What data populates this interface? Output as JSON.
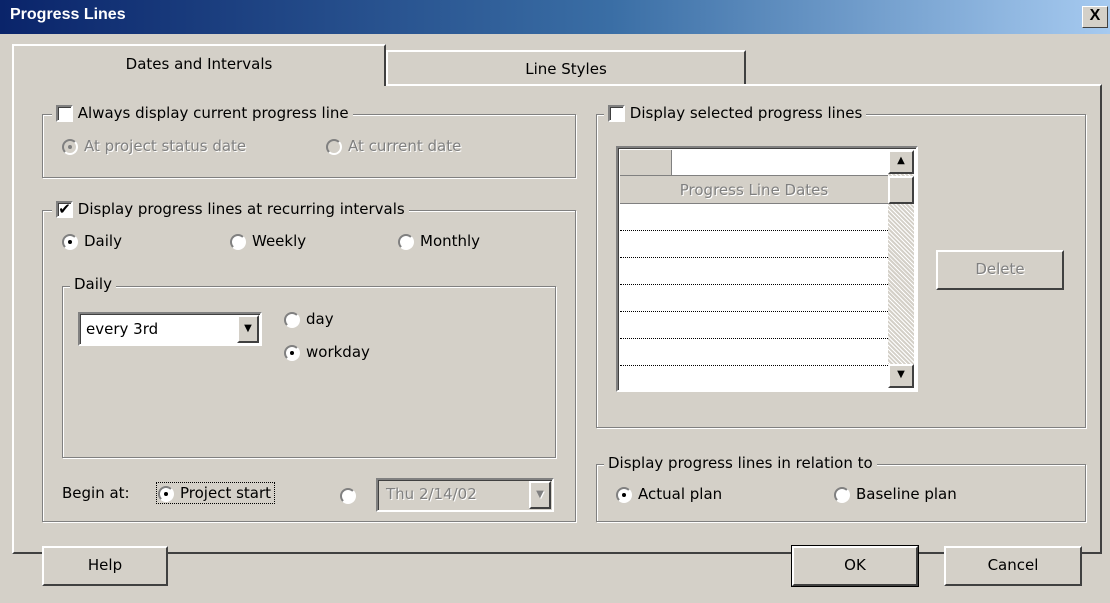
{
  "window": {
    "title": "Progress Lines",
    "close_glyph": "X"
  },
  "tabs": [
    {
      "label": "Dates and Intervals",
      "active": true
    },
    {
      "label": "Line Styles",
      "active": false
    }
  ],
  "current_line": {
    "label": "Always display current progress line",
    "checked": false,
    "options": [
      "At project status date",
      "At current date"
    ]
  },
  "recurring": {
    "label": "Display progress lines at recurring intervals",
    "checked": true,
    "options": [
      "Daily",
      "Weekly",
      "Monthly"
    ],
    "selected": "Daily",
    "daily": {
      "group_label": "Daily",
      "frequency_value": "every 3rd",
      "unit_options": [
        "day",
        "workday"
      ],
      "unit_selected": "workday"
    },
    "begin_at": {
      "label": "Begin at:",
      "project_start_label": "Project start",
      "date_value": "Thu 2/14/02"
    }
  },
  "selected_lines": {
    "label": "Display selected progress lines",
    "checked": false,
    "grid_header": "Progress Line Dates",
    "delete_label": "Delete"
  },
  "relation": {
    "label": "Display progress lines in relation to",
    "options": [
      "Actual plan",
      "Baseline plan"
    ],
    "selected": "Actual plan"
  },
  "buttons": {
    "help": "Help",
    "ok": "OK",
    "cancel": "Cancel"
  },
  "icons": {
    "dropdown": "chevron-down-icon",
    "scroll_up": "arrow-up-icon",
    "scroll_down": "arrow-down-icon"
  }
}
